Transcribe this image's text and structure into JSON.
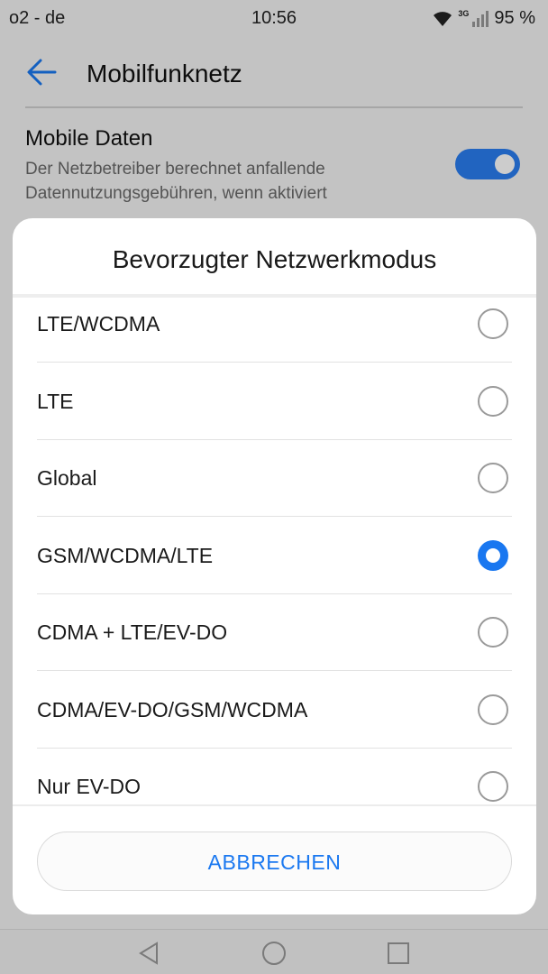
{
  "status_bar": {
    "carrier": "o2 - de",
    "time": "10:56",
    "network_type": "3G",
    "battery": "95 %"
  },
  "app_bar": {
    "title": "Mobilfunknetz",
    "back_icon": "arrow-left-icon"
  },
  "setting": {
    "title": "Mobile Daten",
    "description": "Der Netzbetreiber berechnet anfallende Datennutzungsgebühren, wenn aktiviert",
    "enabled": true
  },
  "dialog": {
    "title": "Bevorzugter Netzwerkmodus",
    "options": [
      {
        "label": "LTE/WCDMA",
        "selected": false
      },
      {
        "label": "LTE",
        "selected": false
      },
      {
        "label": "Global",
        "selected": false
      },
      {
        "label": "GSM/WCDMA/LTE",
        "selected": true
      },
      {
        "label": "CDMA + LTE/EV-DO",
        "selected": false
      },
      {
        "label": "CDMA/EV-DO/GSM/WCDMA",
        "selected": false
      },
      {
        "label": "Nur EV-DO",
        "selected": false
      }
    ],
    "cancel_label": "ABBRECHEN"
  },
  "colors": {
    "accent": "#1977f0",
    "toggle_on": "#2a7df0"
  },
  "nav_bar": {
    "icons": [
      "back-triangle-icon",
      "home-circle-icon",
      "recents-square-icon"
    ]
  }
}
